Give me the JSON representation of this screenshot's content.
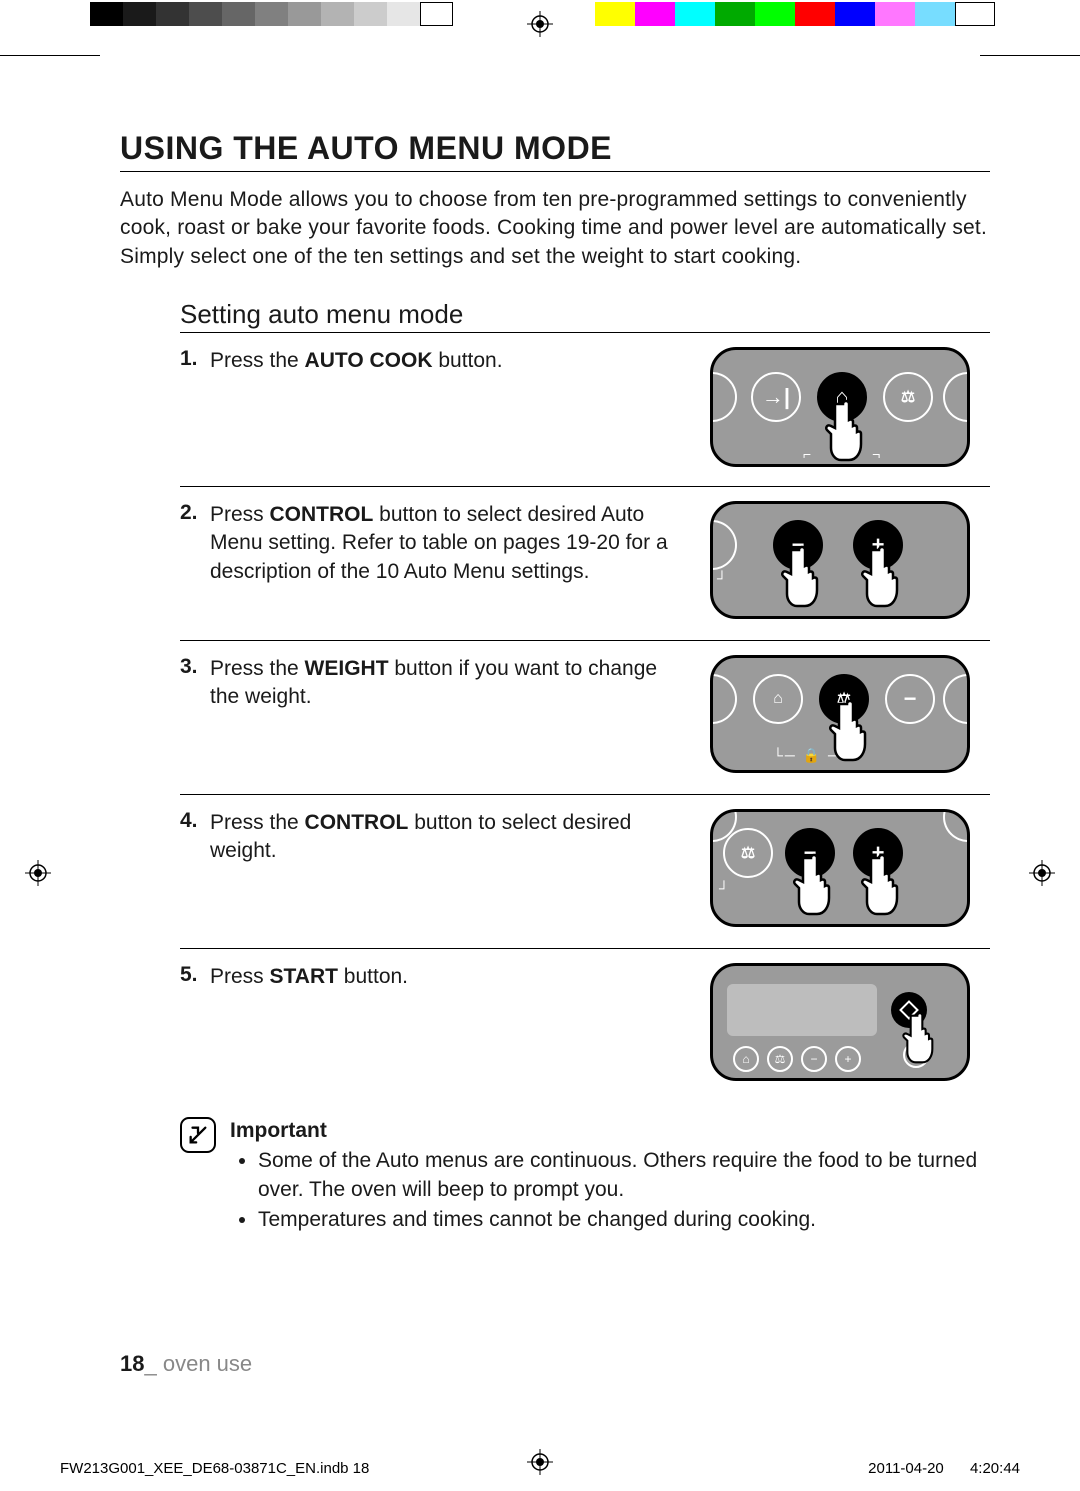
{
  "heading": "USING THE AUTO MENU MODE",
  "intro": "Auto Menu Mode allows you to choose from ten pre-programmed settings to conveniently cook, roast or bake your favorite foods. Cooking time and power level are automatically set. Simply select one of the ten settings and set the weight to start cooking.",
  "subheading": "Setting auto menu mode",
  "steps": [
    {
      "num": "1.",
      "pre": "Press the ",
      "bold": "AUTO COOK",
      "post": " button."
    },
    {
      "num": "2.",
      "pre": "Press ",
      "bold": "CONTROL",
      "post": " button to select desired Auto Menu setting. Refer to table on pages 19-20 for a description of the 10 Auto Menu settings."
    },
    {
      "num": "3.",
      "pre": "Press the ",
      "bold": "WEIGHT",
      "post": " button if you want to change the weight."
    },
    {
      "num": "4.",
      "pre": "Press the ",
      "bold": "CONTROL",
      "post": " button to select desired weight."
    },
    {
      "num": "5.",
      "pre": "Press ",
      "bold": "START",
      "post": " button."
    }
  ],
  "important": {
    "title": "Important",
    "bullets": [
      "Some of the Auto menus are continuous. Others require the food to be turned over. The oven will beep to prompt you.",
      "Temperatures and times cannot be changed during cooking."
    ]
  },
  "footer": {
    "page_num": "18",
    "sep": "_",
    "section": " oven use",
    "file": "FW213G001_XEE_DE68-03871C_EN.indb   18",
    "date": "2011-04-20",
    "time": "4:20:44"
  }
}
